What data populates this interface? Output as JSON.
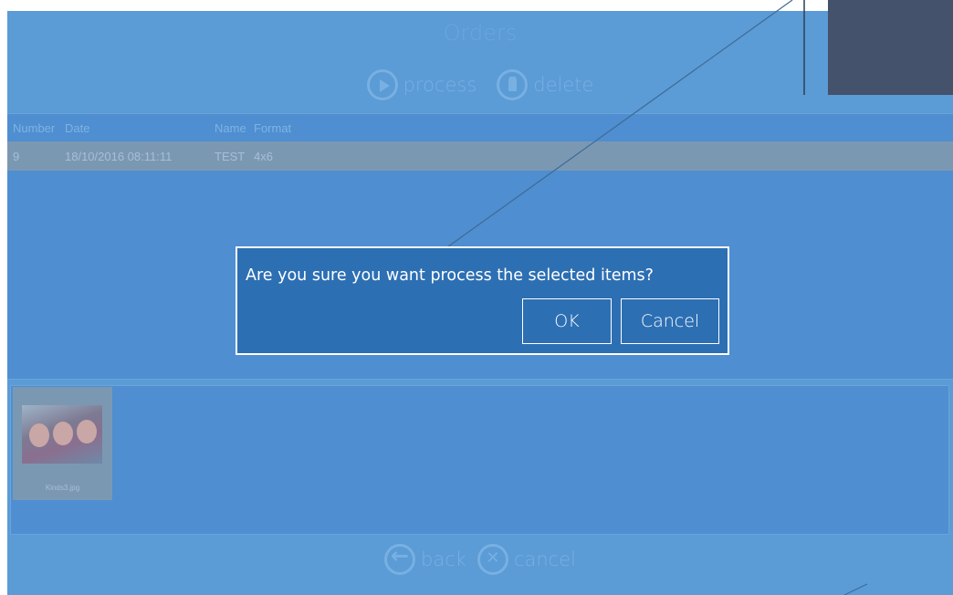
{
  "app": {
    "title": "Orders",
    "toolbar": {
      "process_label": "process",
      "delete_label": "delete"
    },
    "list": {
      "columns": [
        "Number",
        "Date",
        "Name",
        "Format"
      ],
      "rows": [
        {
          "number": "9",
          "date": "18/10/2016 08:11:11",
          "name": "TEST",
          "format": "4x6"
        }
      ]
    },
    "thumbnails": [
      {
        "filename": "Kinds3.jpg"
      }
    ],
    "bottom": {
      "back_label": "back",
      "cancel_label": "cancel"
    }
  },
  "dialog": {
    "message": "Are you sure you want process the selected items?",
    "ok_label": "OK",
    "cancel_label": "Cancel"
  },
  "colors": {
    "app_background": "#5b9bd6",
    "dialog_background": "#2d6fb3",
    "selected_row": "#7b98b3",
    "corner_box": "#44526b"
  },
  "icons": [
    "play-icon",
    "trash-icon",
    "back-arrow-icon",
    "cancel-x-icon"
  ]
}
